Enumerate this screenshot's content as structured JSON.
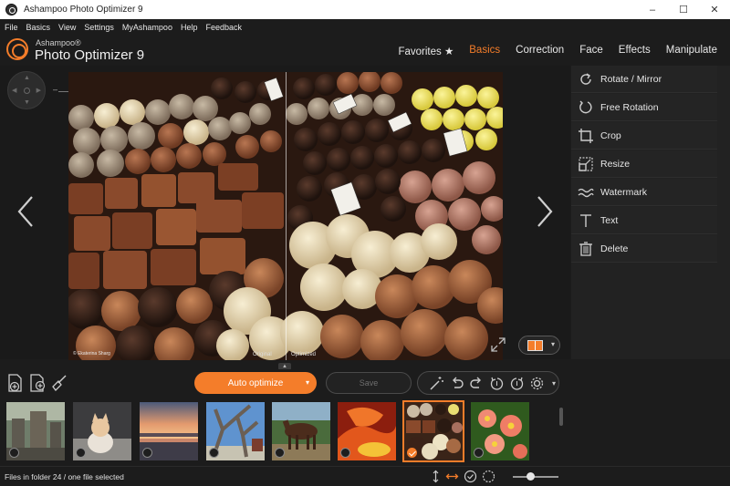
{
  "window": {
    "title": "Ashampoo Photo Optimizer 9",
    "controls": [
      "–",
      "☐",
      "✕"
    ]
  },
  "menu": [
    "File",
    "Basics",
    "View",
    "Settings",
    "MyAshampoo",
    "Help",
    "Feedback"
  ],
  "brand": {
    "small": "Ashampoo®",
    "big": "Photo Optimizer 9",
    "accent": "#f47d2a"
  },
  "tabs": [
    {
      "label": "Favorites ★",
      "active": false
    },
    {
      "label": "Basics",
      "active": true
    },
    {
      "label": "Correction",
      "active": false
    },
    {
      "label": "Face",
      "active": false
    },
    {
      "label": "Effects",
      "active": false
    },
    {
      "label": "Manipulate",
      "active": false
    }
  ],
  "viewer": {
    "zoom_minus": "–",
    "zoom_plus": "+",
    "credit": "© Ekaterina Sharg",
    "label_original": "Original",
    "label_optimized": "Optimized"
  },
  "side_tools": [
    {
      "label": "Rotate / Mirror",
      "icon": "rotate-icon"
    },
    {
      "label": "Free Rotation",
      "icon": "free-rotation-icon"
    },
    {
      "label": "Crop",
      "icon": "crop-icon"
    },
    {
      "label": "Resize",
      "icon": "resize-icon"
    },
    {
      "label": "Watermark",
      "icon": "watermark-icon"
    },
    {
      "label": "Text",
      "icon": "text-icon"
    },
    {
      "label": "Delete",
      "icon": "trash-icon"
    }
  ],
  "toolbar": {
    "auto_optimize_label": "Auto optimize",
    "save_label": "Save",
    "collapse_glyph": "▲",
    "dropdown_glyph": "▾"
  },
  "filmstrip": {
    "thumbnails": [
      {
        "name": "ruins",
        "selected": false
      },
      {
        "name": "cat",
        "selected": false
      },
      {
        "name": "sunset-beach",
        "selected": false
      },
      {
        "name": "tree-sky",
        "selected": false
      },
      {
        "name": "horse",
        "selected": false
      },
      {
        "name": "orange-flower",
        "selected": false
      },
      {
        "name": "chocolates",
        "selected": true
      },
      {
        "name": "pink-flowers",
        "selected": false
      }
    ]
  },
  "status": {
    "text": "Files in folder 24 / one file selected"
  }
}
